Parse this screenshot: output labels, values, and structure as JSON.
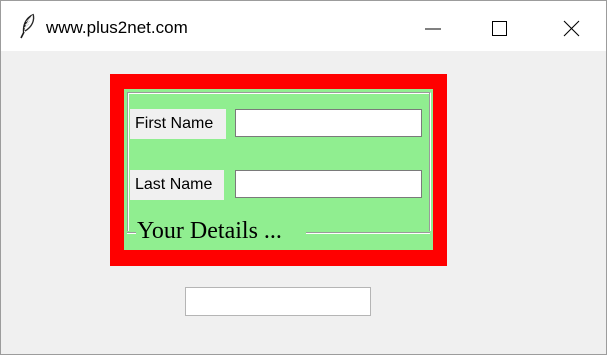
{
  "window": {
    "title": "www.plus2net.com",
    "icon": "feather-icon",
    "controls": {
      "minimize_icon": "minimize-icon",
      "maximize_icon": "maximize-icon",
      "close_icon": "close-icon"
    }
  },
  "form": {
    "frame_color": "#ff0000",
    "panel_color": "#90ee90",
    "legend": "Your Details ...",
    "fields": [
      {
        "label": "First Name",
        "value": ""
      },
      {
        "label": "Last Name",
        "value": ""
      }
    ]
  },
  "bottom_entry": {
    "value": ""
  }
}
